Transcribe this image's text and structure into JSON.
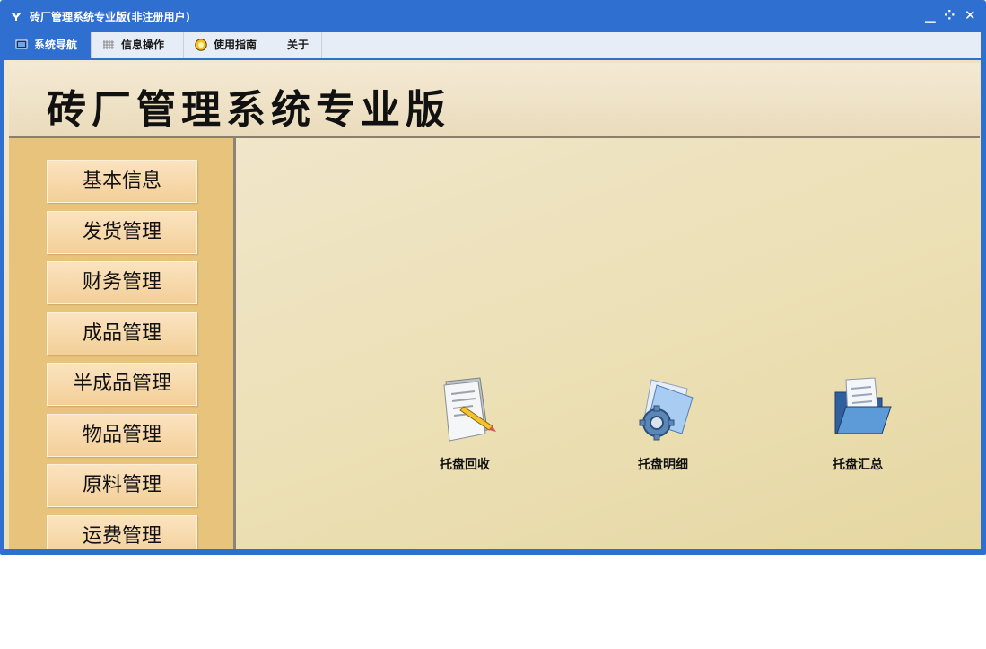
{
  "window": {
    "title": "砖厂管理系统专业版(非注册用户)",
    "controls": {
      "minimize": "▁",
      "restore": "⁘",
      "close": "✕"
    }
  },
  "menubar": {
    "items": [
      {
        "label": "系统导航",
        "icon": "monitor-icon",
        "active": true
      },
      {
        "label": "信息操作",
        "icon": "grid-icon",
        "active": false
      },
      {
        "label": "使用指南",
        "icon": "help-icon",
        "active": false
      },
      {
        "label": "关于",
        "icon": "",
        "active": false
      }
    ]
  },
  "banner": {
    "title": "砖厂管理系统专业版"
  },
  "sidebar": {
    "items": [
      {
        "label": "基本信息"
      },
      {
        "label": "发货管理"
      },
      {
        "label": "财务管理"
      },
      {
        "label": "成品管理"
      },
      {
        "label": "半成品管理"
      },
      {
        "label": "物品管理"
      },
      {
        "label": "原料管理"
      },
      {
        "label": "运费管理"
      }
    ]
  },
  "main": {
    "tiles": [
      {
        "label": "托盘回收",
        "icon": "notepad-pencil-icon"
      },
      {
        "label": "托盘明细",
        "icon": "settings-folder-icon"
      },
      {
        "label": "托盘汇总",
        "icon": "open-folder-icon"
      }
    ]
  },
  "colors": {
    "window_frame": "#2e6fcf",
    "menubar_bg": "#e6edf6",
    "sidebar_bg": "#e8c37c",
    "content_bg": "#ece0b6"
  }
}
